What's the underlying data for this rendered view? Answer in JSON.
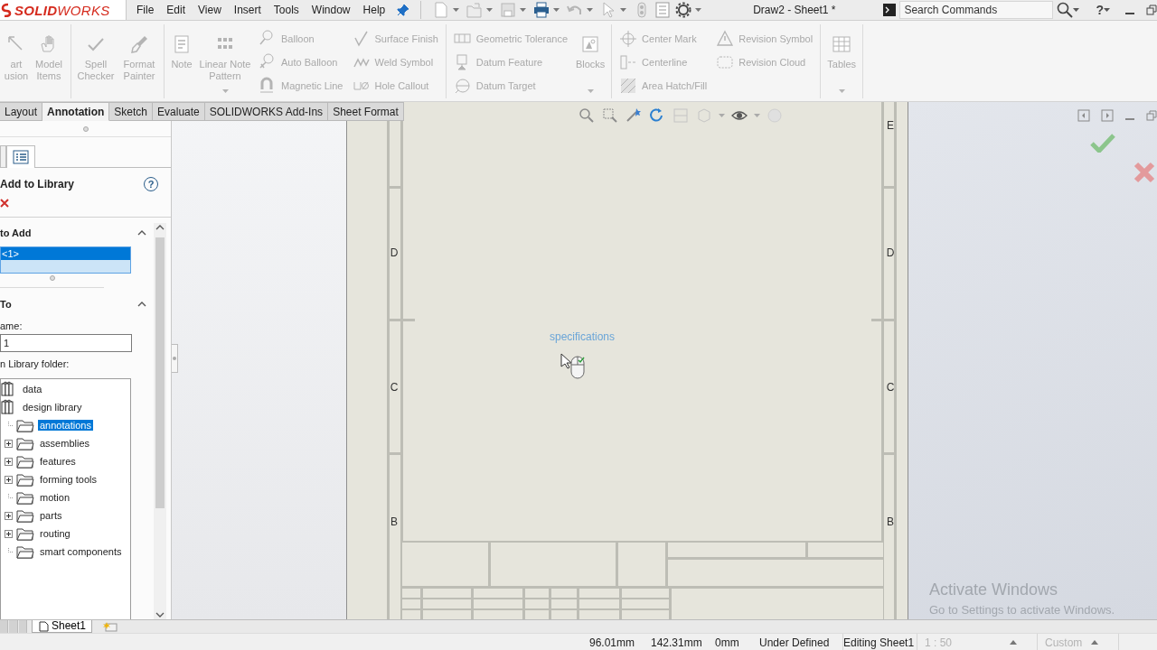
{
  "app_logo": "**SOLID**WORKS",
  "menu": [
    "File",
    "Edit",
    "View",
    "Insert",
    "Tools",
    "Window",
    "Help"
  ],
  "document_title": "Draw2 - Sheet1 *",
  "search": {
    "placeholder": "Search Commands"
  },
  "help_button": "?",
  "ribbon": {
    "groups": [
      {
        "items": [
          {
            "kind": "large",
            "label": "art usion",
            "disabled": true,
            "dropdown": false
          },
          {
            "kind": "large",
            "label": "Model Items",
            "disabled": true,
            "dropdown": false
          }
        ]
      },
      {
        "items": [
          {
            "kind": "large",
            "label": "Spell Checker",
            "disabled": true,
            "dropdown": false
          },
          {
            "kind": "large",
            "label": "Format Painter",
            "disabled": true,
            "dropdown": false
          }
        ]
      },
      {
        "items": [
          {
            "kind": "large",
            "label": "Note",
            "disabled": true,
            "dropdown": false
          },
          {
            "kind": "large",
            "label": "Linear Note Pattern",
            "disabled": true,
            "dropdown": true
          },
          {
            "kind": "stack",
            "items": [
              {
                "label": "Balloon",
                "disabled": true
              },
              {
                "label": "Auto Balloon",
                "disabled": true
              },
              {
                "label": "Magnetic Line",
                "disabled": true
              }
            ]
          },
          {
            "kind": "stack",
            "items": [
              {
                "label": "Surface Finish",
                "disabled": true
              },
              {
                "label": "Weld Symbol",
                "disabled": true
              },
              {
                "label": "Hole Callout",
                "disabled": true
              }
            ]
          }
        ]
      },
      {
        "items": [
          {
            "kind": "stack",
            "items": [
              {
                "label": "Geometric Tolerance",
                "disabled": true
              },
              {
                "label": "Datum Feature",
                "disabled": true
              },
              {
                "label": "Datum Target",
                "disabled": true
              }
            ]
          },
          {
            "kind": "large",
            "label": "Blocks",
            "disabled": true,
            "dropdown": true
          }
        ]
      },
      {
        "items": [
          {
            "kind": "stack",
            "items": [
              {
                "label": "Center Mark",
                "disabled": true
              },
              {
                "label": "Centerline",
                "disabled": true
              },
              {
                "label": "Area Hatch/Fill",
                "disabled": true
              }
            ]
          },
          {
            "kind": "stack",
            "items": [
              {
                "label": "Revision Symbol",
                "disabled": true
              },
              {
                "label": "Revision Cloud",
                "disabled": true
              }
            ]
          }
        ]
      },
      {
        "items": [
          {
            "kind": "large",
            "label": "Tables",
            "disabled": true,
            "dropdown": true
          }
        ]
      }
    ]
  },
  "tabs": [
    {
      "label": "Layout",
      "selected": false
    },
    {
      "label": "Annotation",
      "selected": true
    },
    {
      "label": "Sketch",
      "selected": false
    },
    {
      "label": "Evaluate",
      "selected": false
    },
    {
      "label": "SOLIDWORKS Add-Ins",
      "selected": false
    },
    {
      "label": "Sheet Format",
      "selected": false
    }
  ],
  "property_manager": {
    "title": "Add to Library",
    "help": "?",
    "items_section": {
      "title": "to Add",
      "expanded": true,
      "list": [
        {
          "label": "<1>",
          "selected": true
        }
      ]
    },
    "save_section": {
      "title": "To",
      "expanded": true,
      "name_label": "ame:",
      "name_value": "1",
      "folder_label": "n Library folder:",
      "tree": [
        {
          "label": "data",
          "kind": "library",
          "selected": false
        },
        {
          "label": "design library",
          "kind": "library",
          "selected": false,
          "children": [
            {
              "label": "annotations",
              "kind": "folder",
              "selected": true,
              "expandable": false
            },
            {
              "label": "assemblies",
              "kind": "folder",
              "selected": false,
              "expandable": true
            },
            {
              "label": "features",
              "kind": "folder",
              "selected": false,
              "expandable": true
            },
            {
              "label": "forming tools",
              "kind": "folder",
              "selected": false,
              "expandable": true
            },
            {
              "label": "motion",
              "kind": "folder",
              "selected": false,
              "expandable": false
            },
            {
              "label": "parts",
              "kind": "folder",
              "selected": false,
              "expandable": true
            },
            {
              "label": "routing",
              "kind": "folder",
              "selected": false,
              "expandable": true
            },
            {
              "label": "smart components",
              "kind": "folder",
              "selected": false,
              "expandable": false
            }
          ]
        }
      ]
    }
  },
  "sheet": {
    "zones_left": [
      "D",
      "C",
      "B"
    ],
    "zones_right": [
      "E",
      "D",
      "C",
      "B"
    ],
    "note": "specifications"
  },
  "activation": {
    "title": "Activate Windows",
    "subtitle": "Go to Settings to activate Windows."
  },
  "sheet_tabs": [
    {
      "label": "Sheet1",
      "selected": true
    }
  ],
  "status_bar": {
    "readouts": [
      "96.01mm",
      "142.31mm",
      "0mm",
      "Under Defined",
      "Editing Sheet1"
    ],
    "scale": {
      "value": "1 : 50",
      "disabled": true
    },
    "units": {
      "value": "Custom",
      "disabled": true
    }
  }
}
